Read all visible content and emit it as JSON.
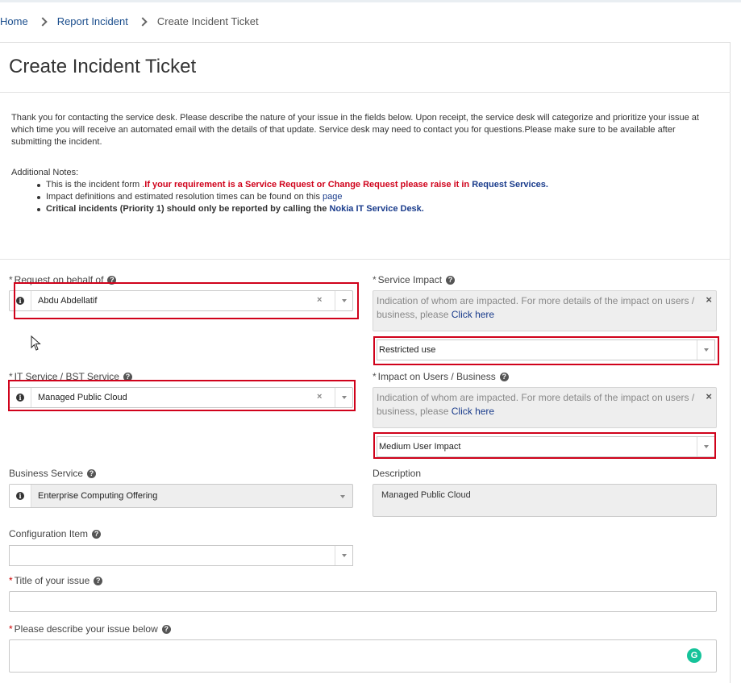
{
  "breadcrumb": {
    "home": "Home",
    "report": "Report Incident",
    "current": "Create Incident Ticket"
  },
  "page": {
    "title": "Create Incident Ticket",
    "intro": "Thank you for contacting the service desk. Please describe the nature of your issue in the fields below. Upon receipt, the service desk will categorize and prioritize your issue at which time you will receive an automated email with the details of that update. Service desk may need to contact you for questions.Please make sure to be available after submitting the incident.",
    "notes_heading": "Additional Notes:",
    "note1_prefix": "This is the incident form .",
    "note1_red": "If your requirement is a Service Request or Change Request please raise it in ",
    "note1_link": "Request Services.",
    "note2_prefix": "Impact definitions and estimated resolution times can be found on this ",
    "note2_link": "page",
    "note3_prefix": "Critical incidents (Priority 1) should only be reported by calling the ",
    "note3_link": "Nokia IT Service Desk."
  },
  "form": {
    "required_mark": "*",
    "help_glyph": "?",
    "info_glyph": "i",
    "clear_glyph": "×",
    "request_on_behalf": {
      "label": "Request on behalf of",
      "value": "Abdu Abdellatif"
    },
    "it_service": {
      "label": "IT Service / BST Service",
      "value": "Managed Public Cloud"
    },
    "business_service": {
      "label": "Business Service",
      "value": "Enterprise Computing Offering"
    },
    "configuration_item": {
      "label": "Configuration Item",
      "value": ""
    },
    "service_impact": {
      "label": "Service Impact",
      "info_text": "Indication of whom are impacted. For more details of the impact on users / business, please ",
      "info_link": "Click here",
      "value": "Restricted use"
    },
    "impact_users": {
      "label": "Impact on Users / Business",
      "info_text": "Indication of whom are impacted. For more details of the impact on users / business, please ",
      "info_link": "Click here",
      "value": "Medium User Impact"
    },
    "description": {
      "label": "Description",
      "value": "Managed Public Cloud"
    },
    "title": {
      "label": "Title of your issue",
      "value": ""
    },
    "issue": {
      "label": "Please describe your issue below",
      "value": ""
    },
    "grammarly_glyph": "G"
  },
  "colors": {
    "highlight": "#d0021b",
    "link": "#1a3c8c",
    "required": "#cc0000",
    "grammarly": "#15c39a"
  },
  "icons": [
    "info-icon",
    "help-icon",
    "clear-icon",
    "chevron-down-icon",
    "close-icon",
    "grammarly-icon",
    "mouse-cursor-icon"
  ]
}
